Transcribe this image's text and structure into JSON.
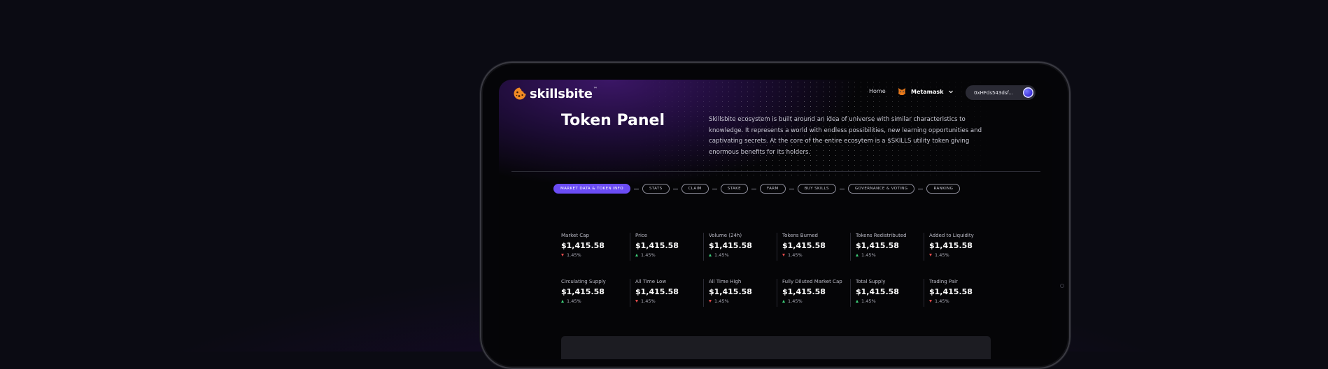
{
  "navbar": {
    "logo_text": "skillsbite",
    "logo_tm": "™",
    "home_label": "Home",
    "wallet_label": "Metamask",
    "address": "0xHFds543dsf..."
  },
  "hero": {
    "title": "Token Panel",
    "description": "Skillsbite ecosystem is built around an idea of universe with similar characteristics to knowledge. It represents a world with endless possibilities, new learning opportunities and captivating secrets. At the core of the entire ecosytem is a $SKILLS utility token giving enormous benefits for its holders."
  },
  "tabs": [
    {
      "label": "MARKET DATA & TOKEN INFO",
      "active": true
    },
    {
      "label": "STATS"
    },
    {
      "label": "CLAIM"
    },
    {
      "label": "STAKE"
    },
    {
      "label": "FARM"
    },
    {
      "label": "BUY SKILLS"
    },
    {
      "label": "GOVERNANCE & VOTING"
    },
    {
      "label": "RANKING"
    }
  ],
  "stats": [
    {
      "label": "Market Cap",
      "value": "$1,415.58",
      "change": "1.45%",
      "direction": "down"
    },
    {
      "label": "Price",
      "value": "$1,415.58",
      "change": "1.45%",
      "direction": "up"
    },
    {
      "label": "Volume (24h)",
      "value": "$1,415.58",
      "change": "1.45%",
      "direction": "up"
    },
    {
      "label": "Tokens Burned",
      "value": "$1,415.58",
      "change": "1.45%",
      "direction": "down"
    },
    {
      "label": "Tokens Redistributed",
      "value": "$1,415.58",
      "change": "1.45%",
      "direction": "up"
    },
    {
      "label": "Added to Liquidity",
      "value": "$1,415.58",
      "change": "1.45%",
      "direction": "down"
    },
    {
      "label": "Circulating Supply",
      "value": "$1,415.58",
      "change": "1.45%",
      "direction": "up"
    },
    {
      "label": "All Time Low",
      "value": "$1,415.58",
      "change": "1.45%",
      "direction": "down"
    },
    {
      "label": "All Time High",
      "value": "$1,415.58",
      "change": "1.45%",
      "direction": "down"
    },
    {
      "label": "Fully Diluted Market Cap",
      "value": "$1,415.58",
      "change": "1.45%",
      "direction": "up"
    },
    {
      "label": "Total Supply",
      "value": "$1,415.58",
      "change": "1.45%",
      "direction": "up"
    },
    {
      "label": "Trading Pair",
      "value": "$1,415.58",
      "change": "1.45%",
      "direction": "down"
    }
  ],
  "colors": {
    "accent": "#6b4cf5",
    "down": "#e24b4b",
    "up": "#3ecf7a",
    "logo_orange": "#f08a24"
  },
  "icons": {
    "logo": "cookie-icon",
    "wallet": "metamask-fox-icon",
    "dropdown": "chevron-down-icon",
    "avatar": "wallet-avatar"
  }
}
